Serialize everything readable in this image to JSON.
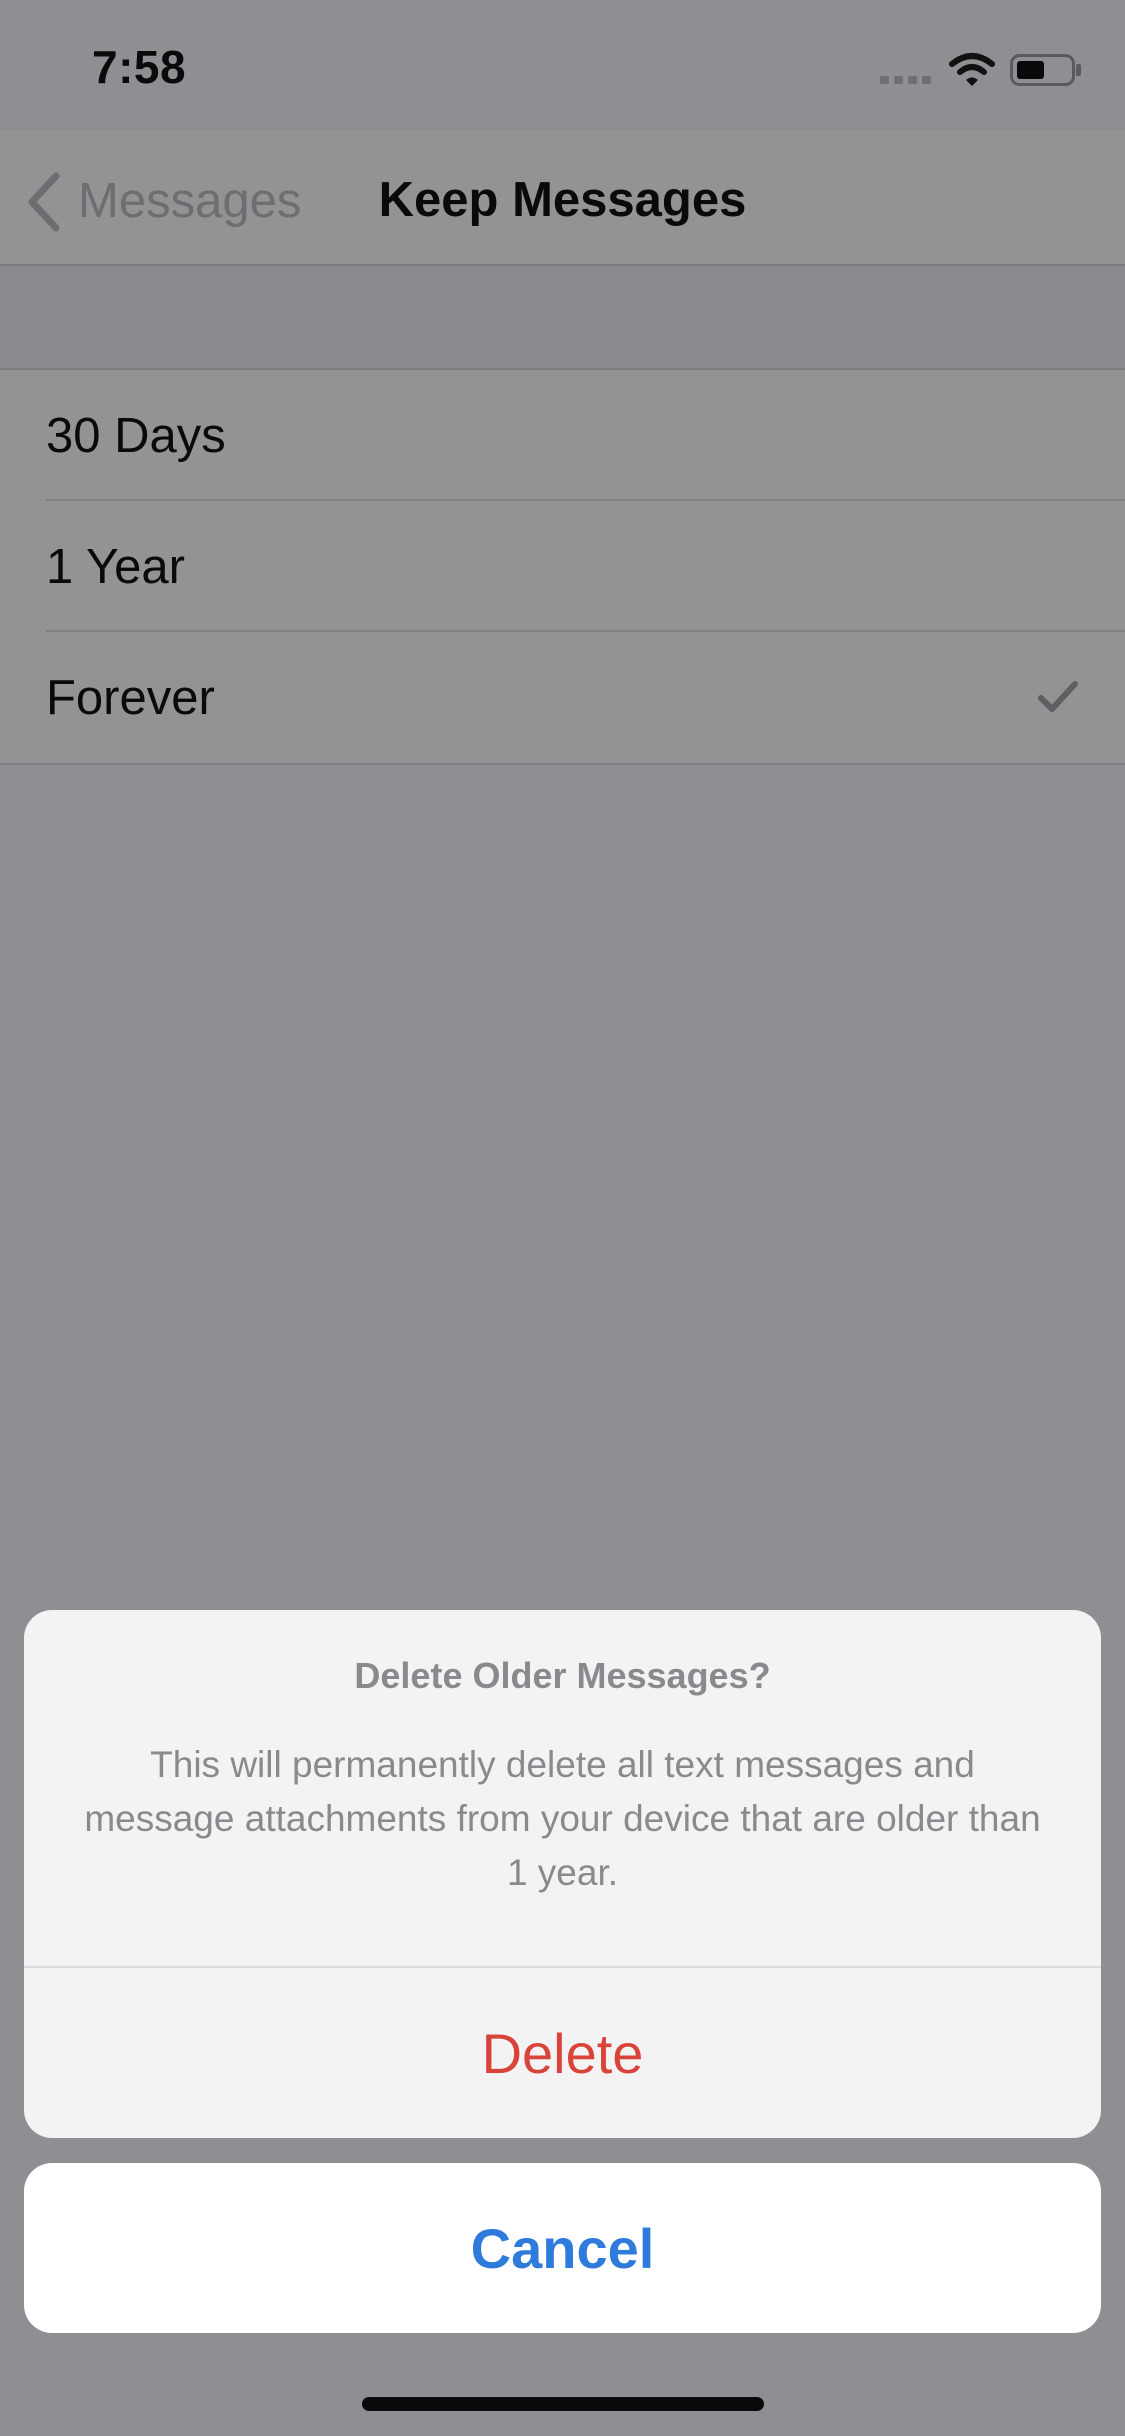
{
  "status_bar": {
    "time": "7:58",
    "signal_icon": "signal-dots-icon",
    "wifi_icon": "wifi-icon",
    "battery_icon": "battery-icon"
  },
  "nav": {
    "back_label": "Messages",
    "back_icon": "chevron-left-icon",
    "title": "Keep Messages"
  },
  "options": [
    {
      "label": "30 Days",
      "selected": false
    },
    {
      "label": "1 Year",
      "selected": false
    },
    {
      "label": "Forever",
      "selected": true
    }
  ],
  "selected_icon": "checkmark-icon",
  "action_sheet": {
    "title": "Delete Older Messages?",
    "message": "This will permanently delete all text messages and message attachments from your device that are older than 1 year.",
    "delete_label": "Delete",
    "cancel_label": "Cancel"
  },
  "colors": {
    "destructive": "#d9443a",
    "accent": "#2f7bdc",
    "dim_background": "#8e8e93"
  }
}
